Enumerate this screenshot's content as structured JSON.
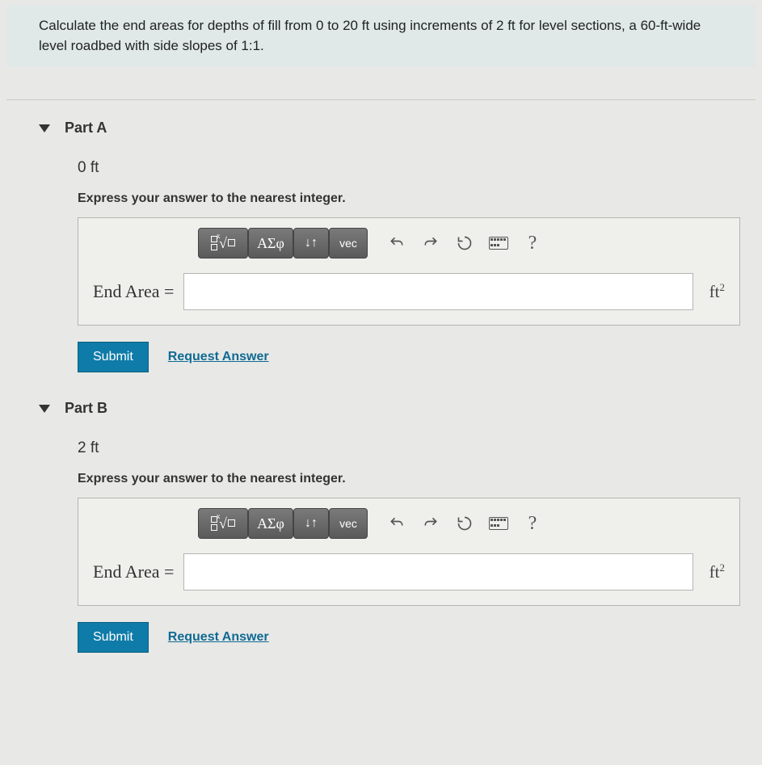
{
  "question": "Calculate the end areas for depths of fill from 0 to 20 ft using increments of 2 ft for level sections, a 60-ft-wide level roadbed with side slopes of 1:1.",
  "toolbar": {
    "greek": "ΑΣφ",
    "subsup": "↓↑",
    "vec": "vec",
    "help": "?"
  },
  "labels": {
    "end_area": "End Area =",
    "unit_base": "ft",
    "unit_exp": "2",
    "submit": "Submit",
    "request": "Request Answer",
    "instruction": "Express your answer to the nearest integer."
  },
  "parts": {
    "a": {
      "title": "Part A",
      "depth": "0 ft",
      "value": ""
    },
    "b": {
      "title": "Part B",
      "depth": "2 ft",
      "value": ""
    }
  }
}
